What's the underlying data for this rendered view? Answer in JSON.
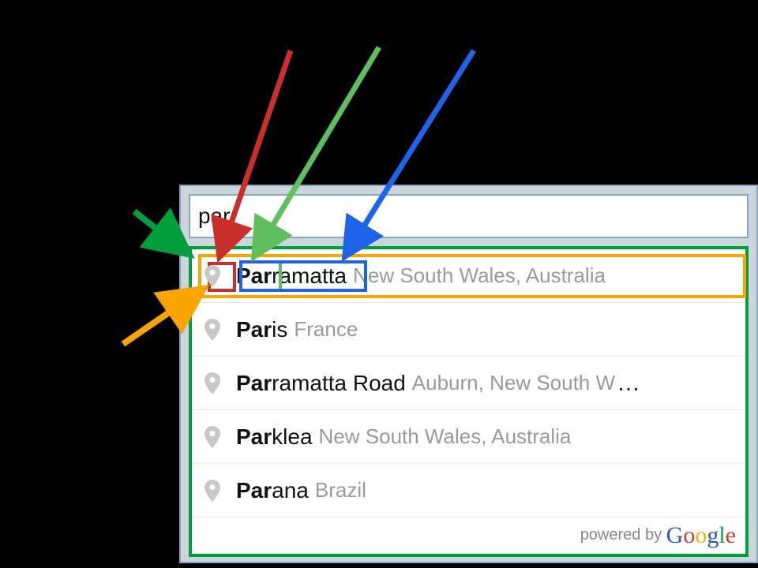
{
  "search": {
    "value": "par"
  },
  "suggestions": [
    {
      "prefix": "Par",
      "rest": "ramatta",
      "detail": "New South Wales, Australia",
      "trunc": false
    },
    {
      "prefix": "Par",
      "rest": "is",
      "detail": "France",
      "trunc": false
    },
    {
      "prefix": "Par",
      "rest": "ramatta Road",
      "detail": "Auburn, New South W",
      "trunc": true
    },
    {
      "prefix": "Par",
      "rest": "klea",
      "detail": "New South Wales, Australia",
      "trunc": false
    },
    {
      "prefix": "Par",
      "rest": "ana",
      "detail": "Brazil",
      "trunc": false
    }
  ],
  "attribution": {
    "prefix": "powered by ",
    "brand": "Google"
  },
  "annotation_colors": {
    "container": "#009e3c",
    "item": "#f9a400",
    "icon": "#c9302c",
    "matched": "#5fbf5f",
    "query": "#1e63e9"
  }
}
